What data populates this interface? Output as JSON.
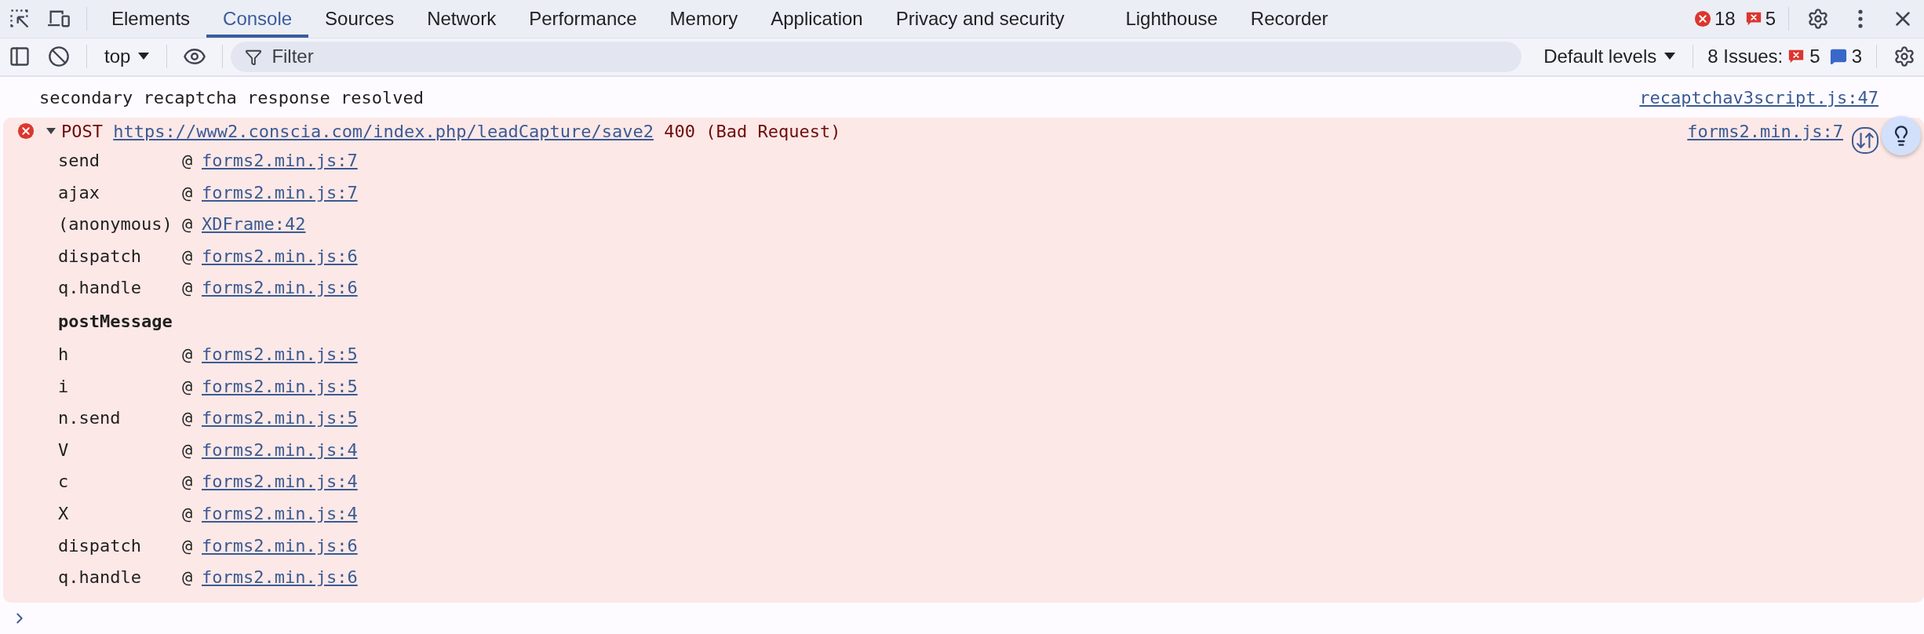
{
  "tabs": [
    {
      "label": "Elements",
      "selected": false
    },
    {
      "label": "Console",
      "selected": true
    },
    {
      "label": "Sources",
      "selected": false
    },
    {
      "label": "Network",
      "selected": false
    },
    {
      "label": "Performance",
      "selected": false
    },
    {
      "label": "Memory",
      "selected": false
    },
    {
      "label": "Application",
      "selected": false
    },
    {
      "label": "Privacy and security",
      "selected": false
    },
    {
      "label": "Lighthouse",
      "selected": false
    },
    {
      "label": "Recorder",
      "selected": false
    }
  ],
  "counters": {
    "errors": "18",
    "issues": "5"
  },
  "toolbar": {
    "context": "top",
    "filter": {
      "placeholder": "Filter"
    },
    "levels": "Default levels",
    "issues": {
      "label": "8 Issues:",
      "errors": "5",
      "info": "3"
    }
  },
  "messages": [
    {
      "kind": "log",
      "text": "secondary recaptcha response resolved",
      "source": "recaptchav3script.js:47"
    },
    {
      "kind": "error",
      "expanded": true,
      "method": "POST",
      "url": "https://www2.conscia.com/index.php/leadCapture/save2",
      "status": "400 (Bad Request)",
      "source": "forms2.min.js:7",
      "stack": [
        {
          "kind": "frame",
          "function": "send",
          "at": "@",
          "location": "forms2.min.js:7"
        },
        {
          "kind": "frame",
          "function": "ajax",
          "at": "@",
          "location": "forms2.min.js:7"
        },
        {
          "kind": "frame",
          "function": "(anonymous)",
          "at": "@",
          "location": "XDFrame:42"
        },
        {
          "kind": "frame",
          "function": "dispatch",
          "at": "@",
          "location": "forms2.min.js:6"
        },
        {
          "kind": "frame",
          "function": "q.handle",
          "at": "@",
          "location": "forms2.min.js:6"
        },
        {
          "kind": "async",
          "label": "postMessage"
        },
        {
          "kind": "frame",
          "function": "h",
          "at": "@",
          "location": "forms2.min.js:5"
        },
        {
          "kind": "frame",
          "function": "i",
          "at": "@",
          "location": "forms2.min.js:5"
        },
        {
          "kind": "frame",
          "function": "n.send",
          "at": "@",
          "location": "forms2.min.js:5"
        },
        {
          "kind": "frame",
          "function": "V",
          "at": "@",
          "location": "forms2.min.js:4"
        },
        {
          "kind": "frame",
          "function": "c",
          "at": "@",
          "location": "forms2.min.js:4"
        },
        {
          "kind": "frame",
          "function": "X",
          "at": "@",
          "location": "forms2.min.js:4"
        },
        {
          "kind": "frame",
          "function": "dispatch",
          "at": "@",
          "location": "forms2.min.js:6"
        },
        {
          "kind": "frame",
          "function": "q.handle",
          "at": "@",
          "location": "forms2.min.js:6"
        }
      ]
    }
  ]
}
